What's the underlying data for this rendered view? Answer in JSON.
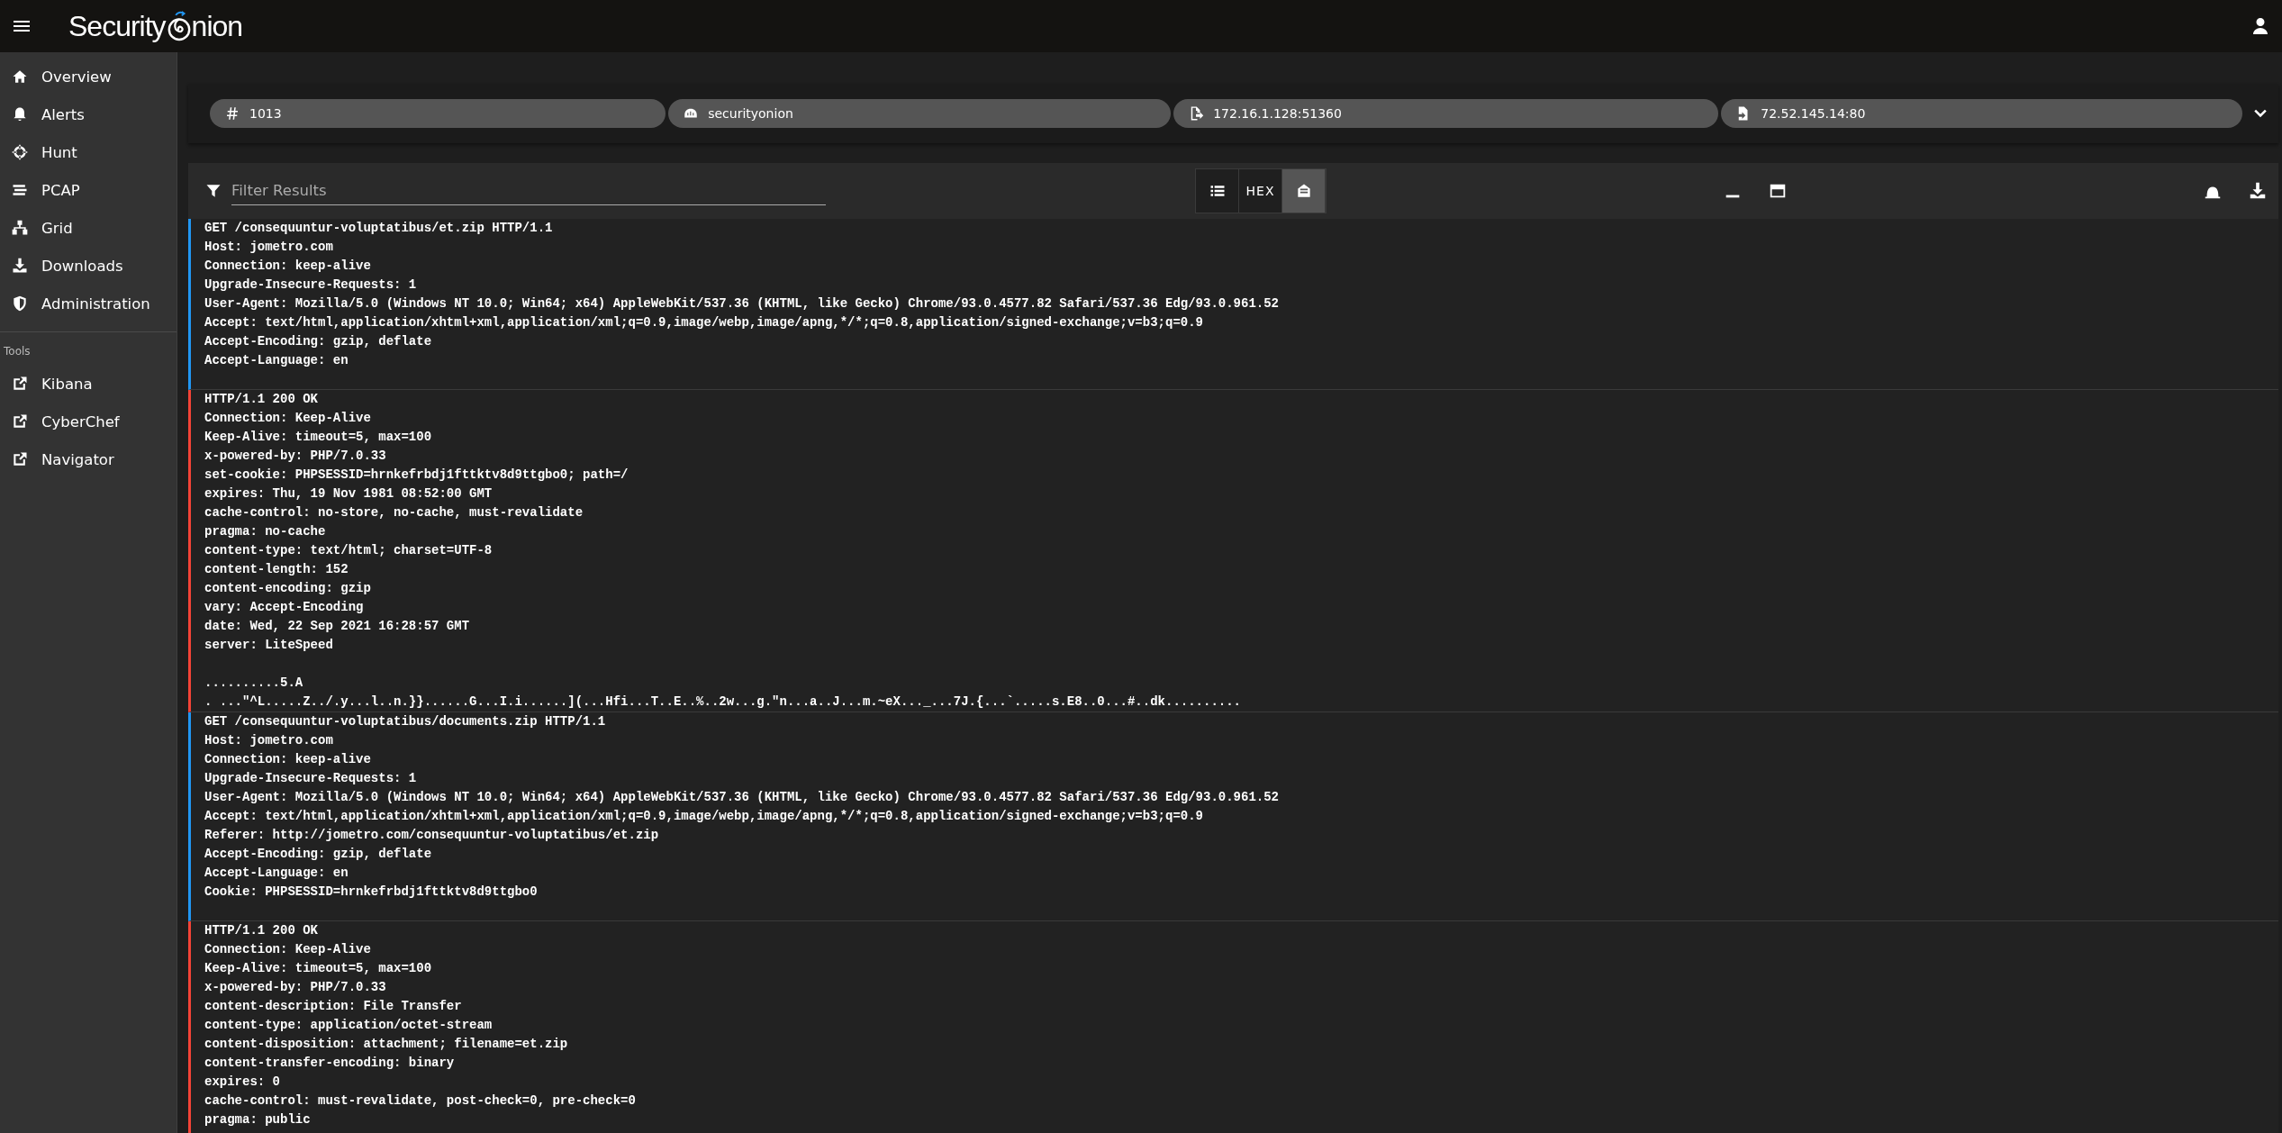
{
  "app_bar": {
    "logo_before": "Security",
    "logo_after": "nion"
  },
  "sidebar": {
    "items": [
      {
        "label": "Overview",
        "selected": false
      },
      {
        "label": "Alerts",
        "selected": false
      },
      {
        "label": "Hunt",
        "selected": false
      },
      {
        "label": "PCAP",
        "selected": false
      },
      {
        "label": "Grid",
        "selected": false
      },
      {
        "label": "Downloads",
        "selected": false
      },
      {
        "label": "Administration",
        "selected": false
      }
    ],
    "tools_heading": "Tools",
    "tools": [
      {
        "label": "Kibana"
      },
      {
        "label": "CyberChef"
      },
      {
        "label": "Navigator"
      }
    ]
  },
  "chips": [
    {
      "text": "1013"
    },
    {
      "text": "securityonion"
    },
    {
      "text": "172.16.1.128:51360"
    },
    {
      "text": "72.52.145.14:80"
    }
  ],
  "filter": {
    "placeholder": "Filter Results"
  },
  "view_buttons": [
    {
      "kind": "list",
      "selected": false
    },
    {
      "kind": "hex",
      "label": "HEX",
      "selected": false
    },
    {
      "kind": "rendered",
      "selected": true
    }
  ],
  "streams": [
    {
      "kind": "request",
      "headers": [
        "GET /consequuntur-voluptatibus/et.zip HTTP/1.1",
        "Host: jometro.com",
        "Connection: keep-alive",
        "Upgrade-Insecure-Requests: 1",
        "User-Agent: Mozilla/5.0 (Windows NT 10.0; Win64; x64) AppleWebKit/537.36 (KHTML, like Gecko) Chrome/93.0.4577.82 Safari/537.36 Edg/93.0.961.52",
        "Accept: text/html,application/xhtml+xml,application/xml;q=0.9,image/webp,image/apng,*/*;q=0.8,application/signed-exchange;v=b3;q=0.9",
        "Accept-Encoding: gzip, deflate",
        "Accept-Language: en"
      ]
    },
    {
      "kind": "response",
      "headers": [
        "HTTP/1.1 200 OK",
        "Connection: Keep-Alive",
        "Keep-Alive: timeout=5, max=100",
        "x-powered-by: PHP/7.0.33",
        "set-cookie: PHPSESSID=hrnkefrbdj1fttktv8d9ttgbo0; path=/",
        "expires: Thu, 19 Nov 1981 08:52:00 GMT",
        "cache-control: no-store, no-cache, must-revalidate",
        "pragma: no-cache",
        "content-type: text/html; charset=UTF-8",
        "content-length: 152",
        "content-encoding: gzip",
        "vary: Accept-Encoding",
        "date: Wed, 22 Sep 2021 16:28:57 GMT",
        "server: LiteSpeed"
      ],
      "body": [
        "..........5.A",
        ". ...\"^L.....Z../.y...l..n.}}......G...I.i......](...Hfi...T..E..%..2w...g.\"n...a..J...m.~eX..._...7J.{...`.....s.E8..0...#..dk.........."
      ]
    },
    {
      "kind": "request",
      "headers": [
        "GET /consequuntur-voluptatibus/documents.zip HTTP/1.1",
        "Host: jometro.com",
        "Connection: keep-alive",
        "Upgrade-Insecure-Requests: 1",
        "User-Agent: Mozilla/5.0 (Windows NT 10.0; Win64; x64) AppleWebKit/537.36 (KHTML, like Gecko) Chrome/93.0.4577.82 Safari/537.36 Edg/93.0.961.52",
        "Accept: text/html,application/xhtml+xml,application/xml;q=0.9,image/webp,image/apng,*/*;q=0.8,application/signed-exchange;v=b3;q=0.9",
        "Referer: http://jometro.com/consequuntur-voluptatibus/et.zip",
        "Accept-Encoding: gzip, deflate",
        "Accept-Language: en",
        "Cookie: PHPSESSID=hrnkefrbdj1fttktv8d9ttgbo0"
      ]
    },
    {
      "kind": "response",
      "headers": [
        "HTTP/1.1 200 OK",
        "Connection: Keep-Alive",
        "Keep-Alive: timeout=5, max=100",
        "x-powered-by: PHP/7.0.33",
        "content-description: File Transfer",
        "content-type: application/octet-stream",
        "content-disposition: attachment; filename=et.zip",
        "content-transfer-encoding: binary",
        "expires: 0",
        "cache-control: must-revalidate, post-check=0, pre-check=0",
        "pragma: public"
      ]
    }
  ]
}
